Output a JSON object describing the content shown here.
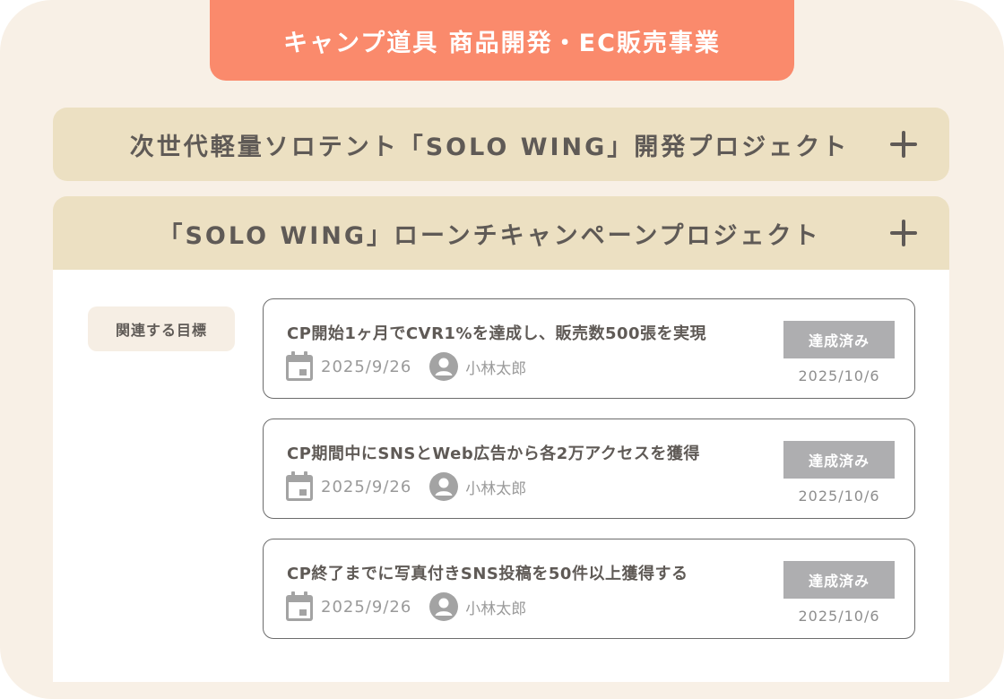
{
  "header": {
    "title": "キャンプ道具 商品開発・EC販売事業"
  },
  "projects": [
    {
      "title": "次世代軽量ソロテント「SOLO WING」開発プロジェクト",
      "toggle_icon": "plus-icon"
    },
    {
      "title": "「SOLO WING」ローンチキャンペーンプロジェクト",
      "toggle_icon": "plus-icon"
    }
  ],
  "related": {
    "label": "関連する目標",
    "goals": [
      {
        "title": "CP開始1ヶ月でCVR1%を達成し、販売数500張を実現",
        "date": "2025/9/26",
        "owner": "小林太郎",
        "status": "達成済み",
        "completed": "2025/10/6"
      },
      {
        "title": "CP期間中にSNSとWeb広告から各2万アクセスを獲得",
        "date": "2025/9/26",
        "owner": "小林太郎",
        "status": "達成済み",
        "completed": "2025/10/6"
      },
      {
        "title": "CP終了までに写真付きSNS投稿を50件以上獲得する",
        "date": "2025/9/26",
        "owner": "小林太郎",
        "status": "達成済み",
        "completed": "2025/10/6"
      }
    ]
  },
  "colors": {
    "header": "#fa8a6c",
    "accordion": "#ece0c2",
    "panel": "#f8f0e6",
    "badge": "#aeaeb0"
  }
}
